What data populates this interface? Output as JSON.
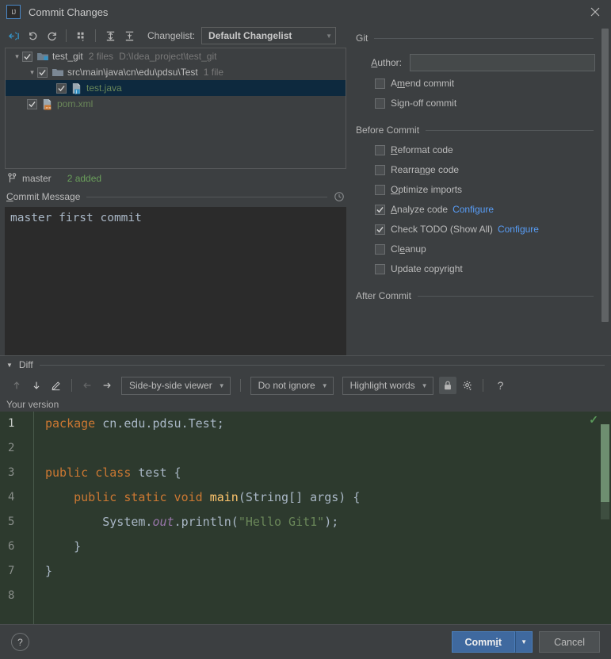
{
  "window": {
    "title": "Commit Changes",
    "logo_text": "IJ",
    "close_icon": "close-icon"
  },
  "toolbar": {
    "buttons": [
      {
        "name": "show-diff-icon",
        "label": ""
      },
      {
        "name": "revert-icon",
        "label": ""
      },
      {
        "name": "refresh-icon",
        "label": ""
      },
      {
        "name": "group-by-icon",
        "label": ""
      },
      {
        "name": "expand-all-icon",
        "label": ""
      },
      {
        "name": "collapse-all-icon",
        "label": ""
      }
    ],
    "changelist_label": "Changelist:",
    "changelist_value": "Default Changelist"
  },
  "tree": {
    "rows": [
      {
        "indent": 0,
        "chevron": "⌄",
        "checked": true,
        "icon": "folder-module-icon",
        "name": "test_git",
        "name_color": "plain",
        "meta": "2 files",
        "path": "D:\\Idea_project\\test_git",
        "selected": false
      },
      {
        "indent": 1,
        "chevron": "⌄",
        "checked": true,
        "icon": "folder-icon",
        "name": "src\\main\\java\\cn\\edu\\pdsu\\Test",
        "name_color": "plain",
        "meta": "1 file",
        "path": "",
        "selected": false
      },
      {
        "indent": 2,
        "chevron": "",
        "checked": true,
        "icon": "java-file-icon",
        "name": "test.java",
        "name_color": "green",
        "meta": "",
        "path": "",
        "selected": true
      },
      {
        "indent": 1,
        "chevron": "",
        "checked": true,
        "icon": "xml-file-icon",
        "name": "pom.xml",
        "name_color": "green",
        "meta": "",
        "path": "",
        "selected": false
      }
    ]
  },
  "branch_strip": {
    "icon": "git-branch-icon",
    "branch": "master",
    "added": "2 added"
  },
  "commit_message": {
    "header_prefix": "C",
    "header_rest": "ommit Message",
    "history_icon": "clock-history-icon",
    "value": "master first commit"
  },
  "git_options": {
    "section_git": "Git",
    "author_label_prefix": "A",
    "author_label_rest": "uthor:",
    "author_value": "",
    "amend": {
      "label_prefix": "A",
      "label_mnemonic": "m",
      "label_rest": "end commit",
      "checked": false
    },
    "signoff": {
      "label_prefix": "Si",
      "label_mnemonic": "g",
      "label_rest": "n-off commit",
      "checked": false
    },
    "section_before": "Before Commit",
    "before_items": [
      {
        "pre": "",
        "mnemonic": "R",
        "post": "eformat code",
        "checked": false,
        "link": ""
      },
      {
        "pre": "Rearra",
        "mnemonic": "n",
        "post": "ge code",
        "checked": false,
        "link": ""
      },
      {
        "pre": "",
        "mnemonic": "O",
        "post": "ptimize imports",
        "checked": false,
        "link": ""
      },
      {
        "pre": "",
        "mnemonic": "A",
        "post": "nalyze code",
        "checked": true,
        "link": "Configure"
      },
      {
        "pre": "Check TODO (Show All)",
        "mnemonic": "",
        "post": "",
        "checked": true,
        "link": "Configure"
      },
      {
        "pre": "Cl",
        "mnemonic": "e",
        "post": "anup",
        "checked": false,
        "link": ""
      },
      {
        "pre": "Update copyright",
        "mnemonic": "",
        "post": "",
        "checked": false,
        "link": ""
      }
    ],
    "section_after": "After Commit"
  },
  "diff": {
    "header_label": "Diff",
    "header_triangle": "▼",
    "toolbar": {
      "prev_diff_icon": "arrow-up-icon",
      "next_diff_icon": "arrow-down-icon",
      "edit_icon": "pencil-icon",
      "left_arrow_icon": "arrow-left-icon",
      "right_arrow_icon": "arrow-right-icon",
      "viewer_mode": "Side-by-side viewer",
      "ignore_mode": "Do not ignore",
      "highlight_mode": "Highlight words",
      "lock_icon": "lock-icon",
      "settings_icon": "gear-icon",
      "help_label": "?"
    },
    "pane_title": "Your version",
    "status_check_icon": "check-icon",
    "lines": [
      {
        "num": "1",
        "current": true,
        "tokens": [
          {
            "cls": "kw",
            "t": "package "
          },
          {
            "cls": "txt",
            "t": "cn.edu.pdsu.Test;"
          }
        ]
      },
      {
        "num": "2",
        "current": false,
        "tokens": []
      },
      {
        "num": "3",
        "current": false,
        "tokens": [
          {
            "cls": "kw",
            "t": "public class "
          },
          {
            "cls": "txt",
            "t": "test {"
          }
        ]
      },
      {
        "num": "4",
        "current": false,
        "tokens": [
          {
            "cls": "txt",
            "t": "    "
          },
          {
            "cls": "kw",
            "t": "public static void "
          },
          {
            "cls": "fn",
            "t": "main"
          },
          {
            "cls": "txt",
            "t": "(String[] args) {"
          }
        ]
      },
      {
        "num": "5",
        "current": false,
        "tokens": [
          {
            "cls": "txt",
            "t": "        System."
          },
          {
            "cls": "fld",
            "t": "out"
          },
          {
            "cls": "txt",
            "t": ".println("
          },
          {
            "cls": "str",
            "t": "\"Hello Git1\""
          },
          {
            "cls": "txt",
            "t": ");"
          }
        ]
      },
      {
        "num": "6",
        "current": false,
        "tokens": [
          {
            "cls": "txt",
            "t": "    }"
          }
        ]
      },
      {
        "num": "7",
        "current": false,
        "tokens": [
          {
            "cls": "txt",
            "t": "}"
          }
        ]
      },
      {
        "num": "8",
        "current": false,
        "tokens": []
      }
    ]
  },
  "footer": {
    "help_label": "?",
    "commit_pre": "Comm",
    "commit_mnemonic": "i",
    "commit_post": "t",
    "commit_arrow": "▼",
    "cancel_label": "Cancel"
  },
  "colors": {
    "accent_blue": "#3f699f",
    "link_blue": "#589df6",
    "added_green": "#6a9f5b",
    "diff_added_bg": "#2d3a2e",
    "selection_bg": "#0d293e",
    "window_bg": "#3c3f41",
    "editor_bg": "#2b2b2b"
  }
}
